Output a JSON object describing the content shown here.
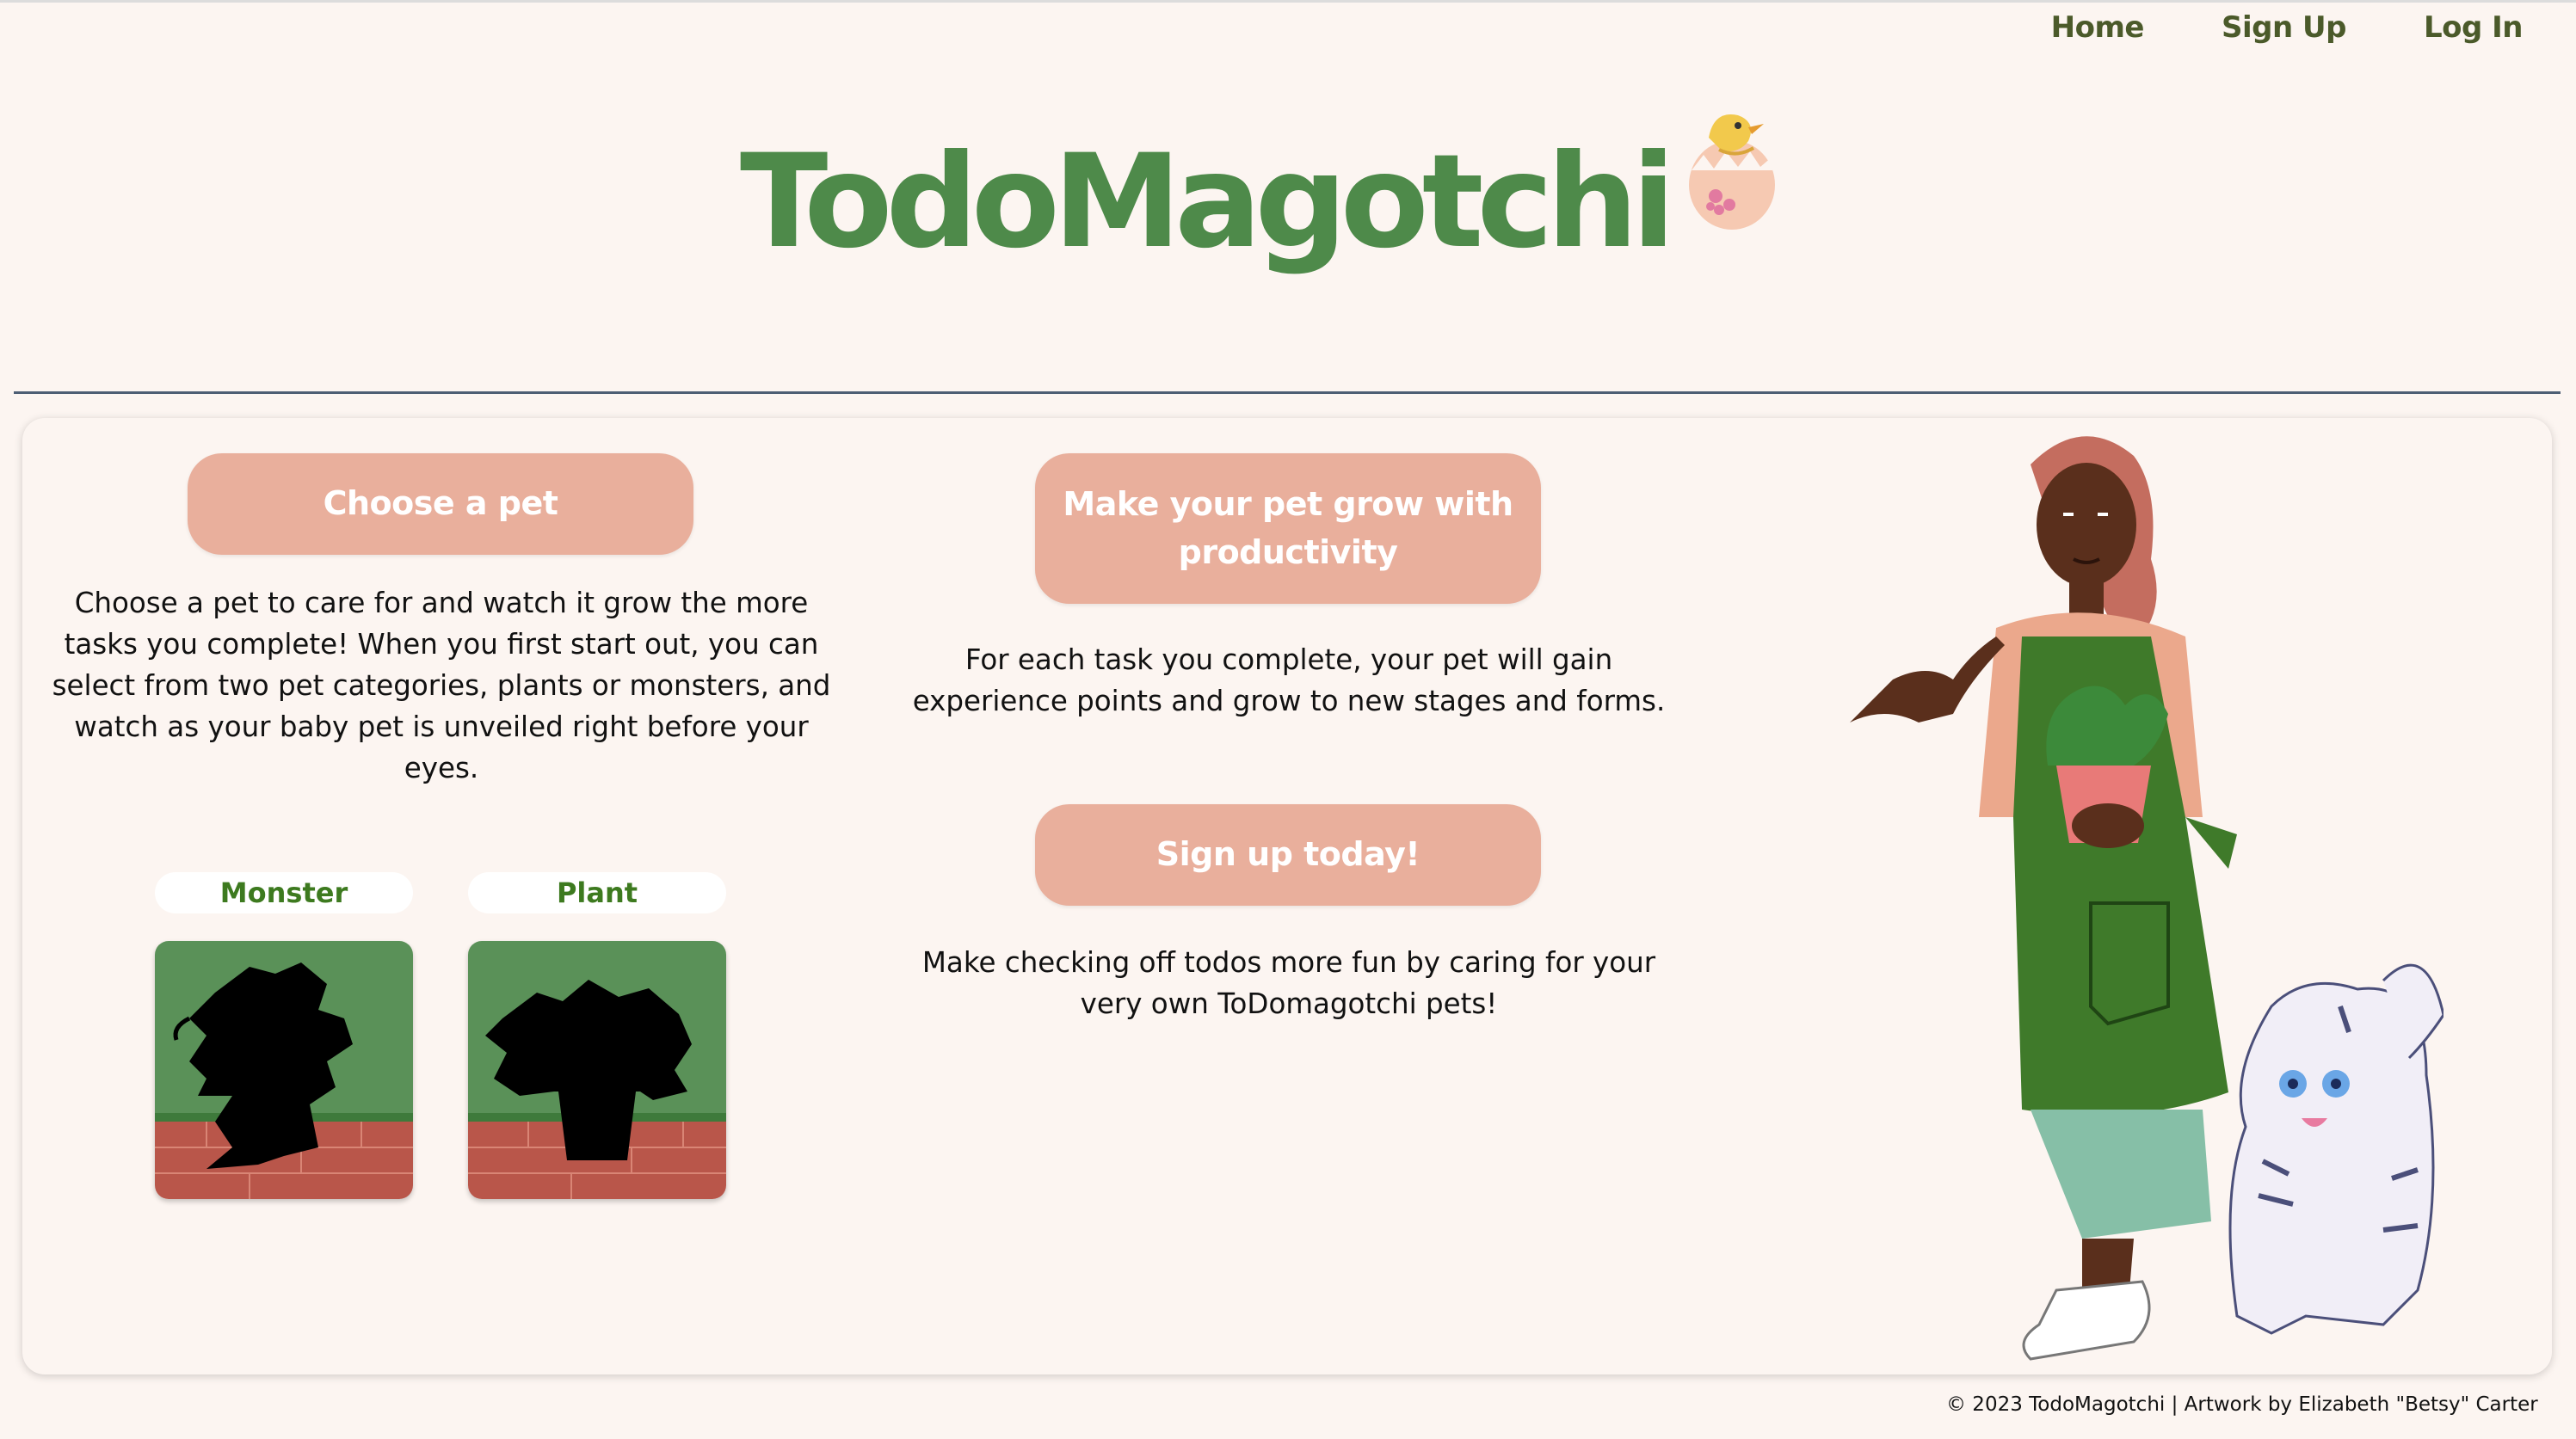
{
  "nav": {
    "items": [
      {
        "label": "Home"
      },
      {
        "label": "Sign Up"
      },
      {
        "label": "Log In"
      }
    ]
  },
  "header": {
    "logo_text": "TodoMagotchi",
    "logo_icon": "hatching-egg-icon"
  },
  "colors": {
    "background": "#fcf5f1",
    "logo_green": "#4e8a4a",
    "nav_text": "#4b5a2a",
    "pill": "#e9af9c",
    "pet_label_text": "#3d7a1f",
    "divider": "#4d5e74"
  },
  "sections": {
    "choose": {
      "heading": "Choose a pet",
      "body": "Choose a pet to care for and watch it grow the more tasks you complete! When you first start out, you can select from two pet categories, plants or monsters, and watch as your baby pet is unveiled right before your eyes."
    },
    "grow": {
      "heading": "Make your pet grow with productivity",
      "body": "For each task you complete, your pet will gain experience points and grow to new stages and forms."
    },
    "signup": {
      "heading": "Sign up today!",
      "body": "Make checking off todos more fun by caring for your very own ToDomagotchi pets!"
    }
  },
  "pets": [
    {
      "label": "Monster",
      "icon": "monster-silhouette-icon"
    },
    {
      "label": "Plant",
      "icon": "plant-silhouette-icon"
    }
  ],
  "footer": {
    "text": "© 2023 TodoMagotchi | Artwork by Elizabeth \"Betsy\" Carter"
  }
}
